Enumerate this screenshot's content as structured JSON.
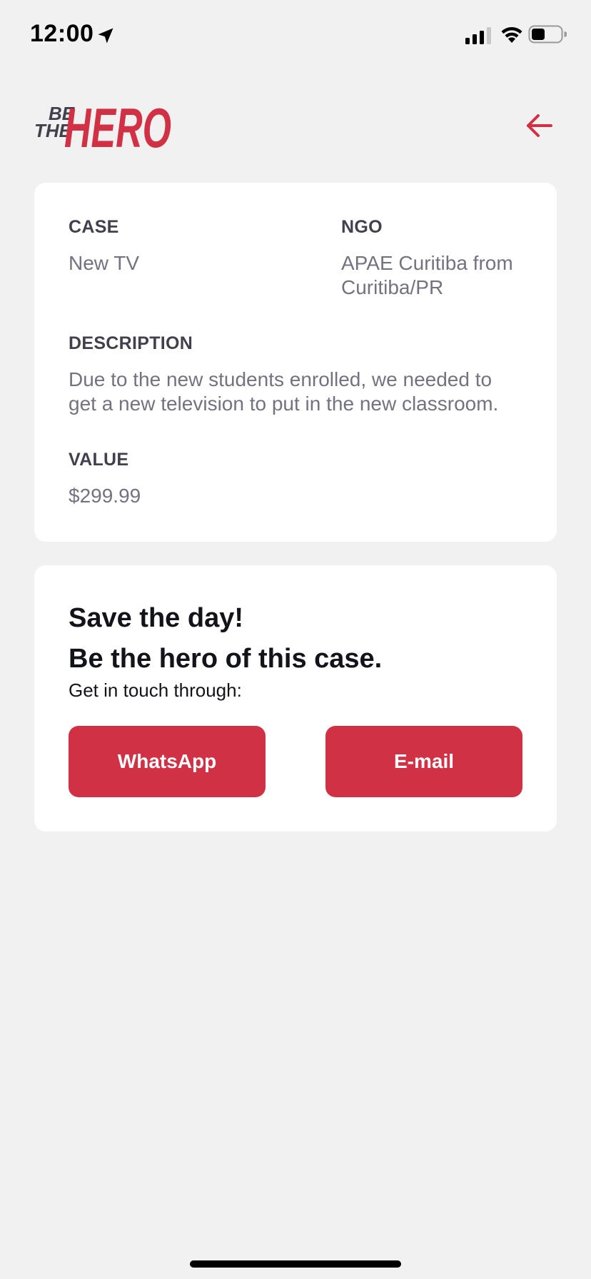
{
  "status_bar": {
    "time": "12:00"
  },
  "header": {
    "logo_top": "BE",
    "logo_middle": "THE",
    "logo_main": "HERO",
    "back_icon": "arrow-left-icon"
  },
  "incident": {
    "case_label": "CASE",
    "case_value": "New TV",
    "ngo_label": "NGO",
    "ngo_value_line1": "APAE Curitiba from",
    "ngo_value_line2": "Curitiba/PR",
    "description_label": "DESCRIPTION",
    "description_line1": "Due to the new students enrolled, we needed to",
    "description_line2": "get a new television to put in the new classroom.",
    "value_label": "VALUE",
    "value_value": "$299.99"
  },
  "contact": {
    "title_line1": "Save the day!",
    "title_line2": "Be the hero of this case.",
    "description": "Get in touch through:",
    "whatsapp_label": "WhatsApp",
    "email_label": "E-mail"
  },
  "colors": {
    "accent": "#D13145",
    "background": "#F1F1F1",
    "card": "#FFFFFF",
    "label": "#41414D",
    "value": "#737380"
  }
}
